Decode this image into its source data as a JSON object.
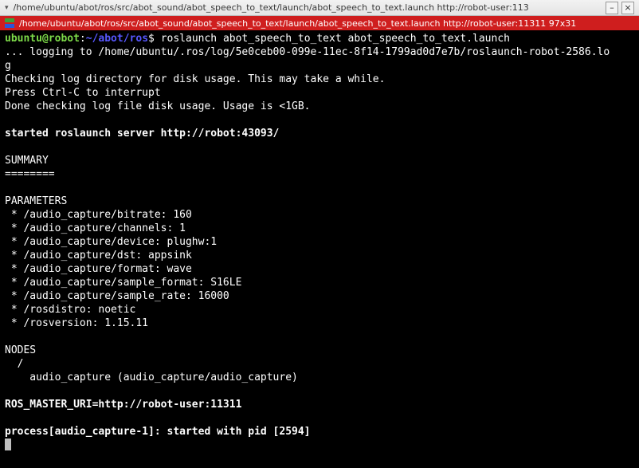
{
  "window": {
    "outer_title": "/home/ubuntu/abot/ros/src/abot_sound/abot_speech_to_text/launch/abot_speech_to_text.launch http://robot-user:113",
    "inner_title": "/home/ubuntu/abot/ros/src/abot_sound/abot_speech_to_text/launch/abot_speech_to_text.launch http://robot-user:11311 97x31",
    "minimize_label": "–",
    "close_label": "×"
  },
  "prompt": {
    "user_host": "ubuntu@robot",
    "separator": ":",
    "cwd": "~/abot/ros",
    "symbol": "$",
    "command": "roslaunch abot_speech_to_text abot_speech_to_text.launch"
  },
  "lines": {
    "logging": "... logging to /home/ubuntu/.ros/log/5e0ceb00-099e-11ec-8f14-1799ad0d7e7b/roslaunch-robot-2586.lo",
    "logging2": "g",
    "check1": "Checking log directory for disk usage. This may take a while.",
    "check2": "Press Ctrl-C to interrupt",
    "check3": "Done checking log file disk usage. Usage is <1GB.",
    "server": "started roslaunch server http://robot:43093/",
    "summary": "SUMMARY",
    "summary_rule": "========",
    "params_header": "PARAMETERS",
    "params": [
      " * /audio_capture/bitrate: 160",
      " * /audio_capture/channels: 1",
      " * /audio_capture/device: plughw:1",
      " * /audio_capture/dst: appsink",
      " * /audio_capture/format: wave",
      " * /audio_capture/sample_format: S16LE",
      " * /audio_capture/sample_rate: 16000",
      " * /rosdistro: noetic",
      " * /rosversion: 1.15.11"
    ],
    "nodes_header": "NODES",
    "nodes_slash": "  /",
    "nodes_entry": "    audio_capture (audio_capture/audio_capture)",
    "ros_master": "ROS_MASTER_URI=http://robot-user:11311",
    "process": "process[audio_capture-1]: started with pid [2594]"
  }
}
